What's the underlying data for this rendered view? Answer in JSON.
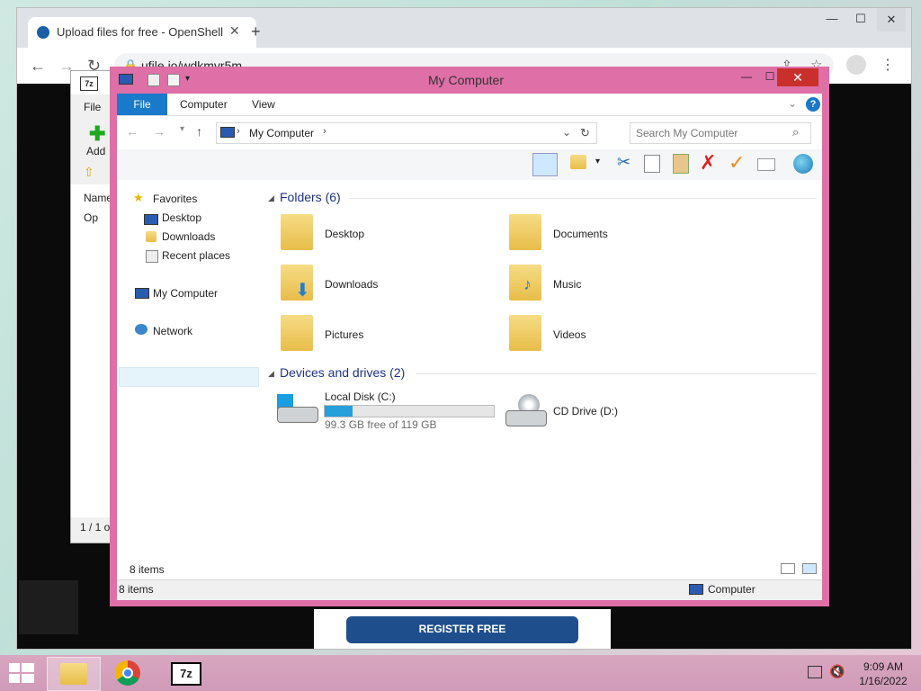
{
  "chrome": {
    "tab_title": "Upload files for free - OpenShell",
    "url": "ufile.io/wdkmyr5m",
    "register_button": "REGISTER FREE"
  },
  "zip": {
    "menu_file": "File",
    "add_label": "Add",
    "column_name": "Name",
    "row_text": "Op",
    "status_text": "1 / 1 o"
  },
  "explorer": {
    "title": "My Computer",
    "ribbon_tabs": [
      "File",
      "Computer",
      "View"
    ],
    "address": "My Computer",
    "search_placeholder": "Search My Computer",
    "nav": {
      "favorites": "Favorites",
      "desktop": "Desktop",
      "downloads": "Downloads",
      "recent": "Recent places",
      "mycomputer": "My Computer",
      "network": "Network"
    },
    "groups": {
      "folders_header": "Folders (6)",
      "devices_header": "Devices and drives (2)"
    },
    "folders": [
      "Desktop",
      "Documents",
      "Downloads",
      "Music",
      "Pictures",
      "Videos"
    ],
    "drives": {
      "local_label": "Local Disk (C:)",
      "local_free": "99.3 GB free of 119 GB",
      "local_used_fraction": 0.166,
      "cd_label": "CD Drive (D:)"
    },
    "status_items": "8 items",
    "status_bar_items": "8 items",
    "status_location": "Computer"
  },
  "taskbar": {
    "time": "9:09 AM",
    "date": "1/16/2022",
    "apps": [
      "file-explorer-icon",
      "chrome-icon",
      "7zip-icon"
    ]
  },
  "colors": {
    "explorer_frame": "#de6fa7",
    "accent": "#1979ca",
    "close": "#c9302c"
  }
}
